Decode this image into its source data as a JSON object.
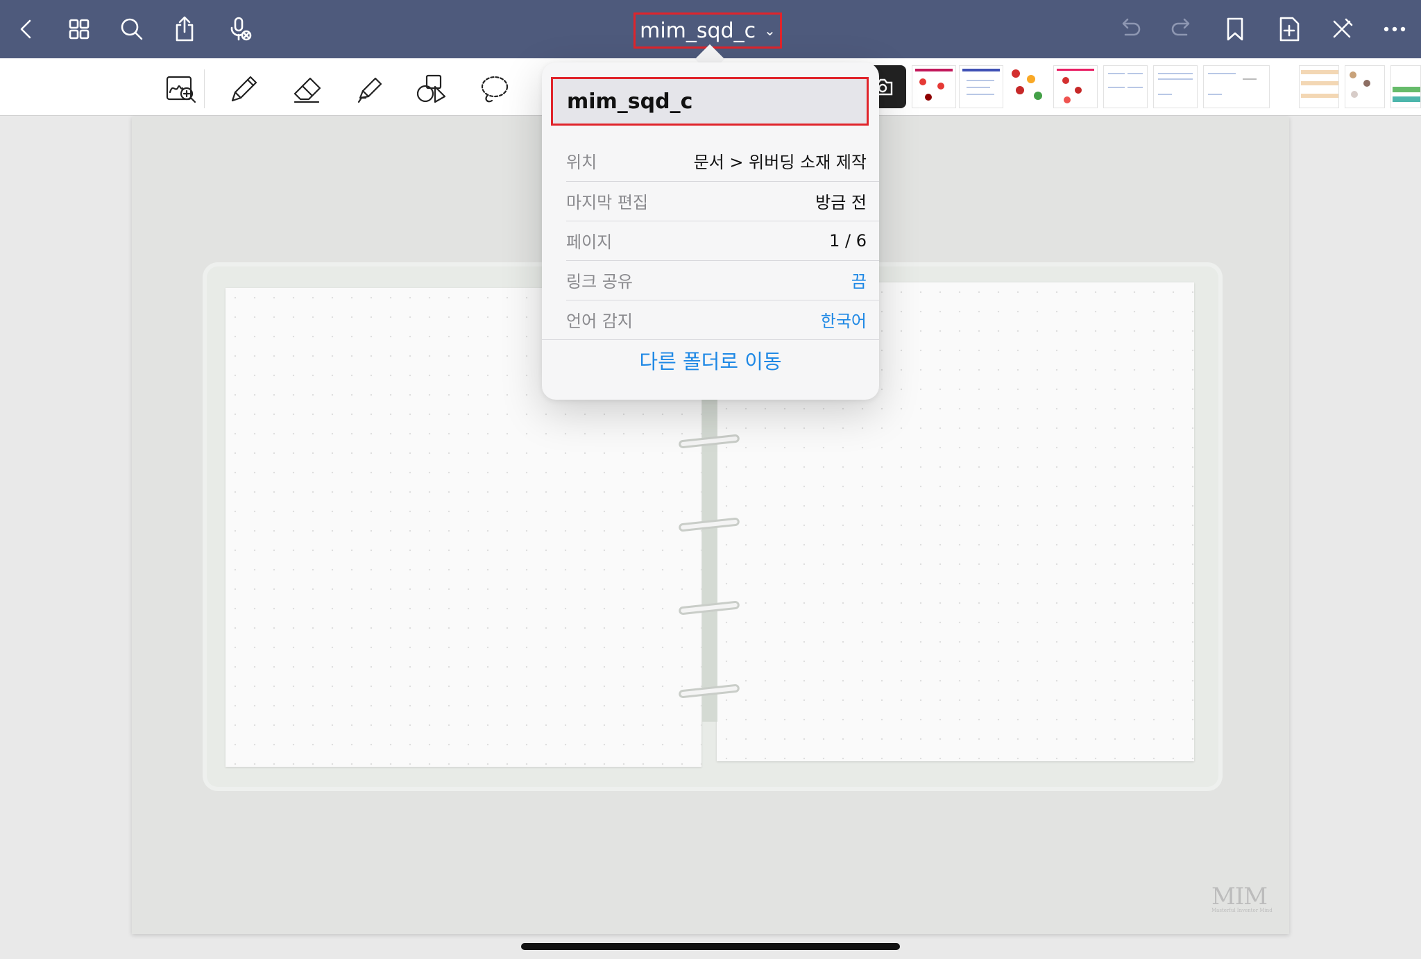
{
  "document": {
    "title": "mim_sqd_c"
  },
  "popover": {
    "name_value": "mim_sqd_c",
    "rows": [
      {
        "label": "위치",
        "value": "문서 > 위버딩 소재 제작"
      },
      {
        "label": "마지막 편집",
        "value": "방금 전"
      },
      {
        "label": "페이지",
        "value": "1 / 6"
      },
      {
        "label": "링크 공유",
        "value": "끔"
      },
      {
        "label": "언어 감지",
        "value": "한국어"
      }
    ],
    "move_button": "다른 폴더로 이동"
  },
  "canvas": {
    "watermark": "MIM",
    "watermark_sub": "Masterful Inventor Mind"
  },
  "icons": {
    "topbar_left": [
      "back-chevron-icon",
      "grid-icon",
      "search-icon",
      "share-icon",
      "mic-off-icon"
    ],
    "topbar_right": [
      "undo-icon",
      "redo-icon",
      "bookmark-icon",
      "add-page-icon",
      "close-tools-icon",
      "more-icon"
    ],
    "tools": [
      "zoom-window-icon",
      "pen-icon",
      "eraser-icon",
      "highlighter-icon",
      "shapes-icon",
      "lasso-icon",
      "camera-icon"
    ]
  },
  "colors": {
    "topbar": "#4e5a7c",
    "accent": "#1e88e5",
    "highlight_box": "#e0242b"
  }
}
